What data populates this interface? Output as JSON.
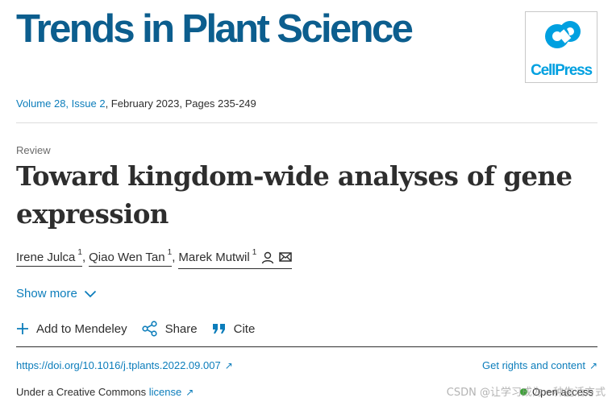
{
  "header": {
    "journal_title": "Trends in Plant Science",
    "logo_text": "CellPress"
  },
  "issue": {
    "volume_link": "Volume 28, Issue 2",
    "details": ", February 2023, Pages 235-249"
  },
  "article": {
    "type": "Review",
    "title": "Toward kingdom-wide analyses of gene expression",
    "authors": [
      {
        "name": "Irene Julca",
        "affiliation": "1"
      },
      {
        "name": "Qiao Wen Tan",
        "affiliation": "1"
      },
      {
        "name": "Marek Mutwil",
        "affiliation": "1"
      }
    ],
    "show_more_label": "Show more"
  },
  "actions": {
    "mendeley_label": "Add to Mendeley",
    "share_label": "Share",
    "cite_label": "Cite"
  },
  "links": {
    "doi": "https://doi.org/10.1016/j.tplants.2022.09.007",
    "rights": "Get rights and content",
    "license_prefix": "Under a Creative Commons ",
    "license_link": "license",
    "open_access": "Open access"
  },
  "watermark": "CSDN @让学习成为一种生活方式",
  "colors": {
    "brand": "#0c5e8e",
    "link": "#0c7dbb",
    "logo": "#00a0e0",
    "open_access": "#3aa335"
  }
}
